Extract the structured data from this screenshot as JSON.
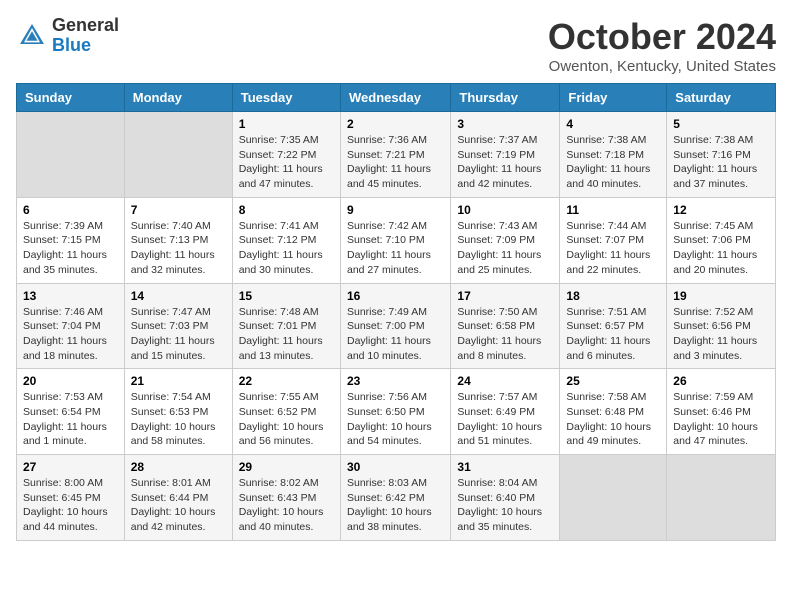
{
  "header": {
    "logo_general": "General",
    "logo_blue": "Blue",
    "month_title": "October 2024",
    "location": "Owenton, Kentucky, United States"
  },
  "days_of_week": [
    "Sunday",
    "Monday",
    "Tuesday",
    "Wednesday",
    "Thursday",
    "Friday",
    "Saturday"
  ],
  "weeks": [
    [
      {
        "day": "",
        "empty": true
      },
      {
        "day": "",
        "empty": true
      },
      {
        "day": "1",
        "sunrise": "Sunrise: 7:35 AM",
        "sunset": "Sunset: 7:22 PM",
        "daylight": "Daylight: 11 hours and 47 minutes."
      },
      {
        "day": "2",
        "sunrise": "Sunrise: 7:36 AM",
        "sunset": "Sunset: 7:21 PM",
        "daylight": "Daylight: 11 hours and 45 minutes."
      },
      {
        "day": "3",
        "sunrise": "Sunrise: 7:37 AM",
        "sunset": "Sunset: 7:19 PM",
        "daylight": "Daylight: 11 hours and 42 minutes."
      },
      {
        "day": "4",
        "sunrise": "Sunrise: 7:38 AM",
        "sunset": "Sunset: 7:18 PM",
        "daylight": "Daylight: 11 hours and 40 minutes."
      },
      {
        "day": "5",
        "sunrise": "Sunrise: 7:38 AM",
        "sunset": "Sunset: 7:16 PM",
        "daylight": "Daylight: 11 hours and 37 minutes."
      }
    ],
    [
      {
        "day": "6",
        "sunrise": "Sunrise: 7:39 AM",
        "sunset": "Sunset: 7:15 PM",
        "daylight": "Daylight: 11 hours and 35 minutes."
      },
      {
        "day": "7",
        "sunrise": "Sunrise: 7:40 AM",
        "sunset": "Sunset: 7:13 PM",
        "daylight": "Daylight: 11 hours and 32 minutes."
      },
      {
        "day": "8",
        "sunrise": "Sunrise: 7:41 AM",
        "sunset": "Sunset: 7:12 PM",
        "daylight": "Daylight: 11 hours and 30 minutes."
      },
      {
        "day": "9",
        "sunrise": "Sunrise: 7:42 AM",
        "sunset": "Sunset: 7:10 PM",
        "daylight": "Daylight: 11 hours and 27 minutes."
      },
      {
        "day": "10",
        "sunrise": "Sunrise: 7:43 AM",
        "sunset": "Sunset: 7:09 PM",
        "daylight": "Daylight: 11 hours and 25 minutes."
      },
      {
        "day": "11",
        "sunrise": "Sunrise: 7:44 AM",
        "sunset": "Sunset: 7:07 PM",
        "daylight": "Daylight: 11 hours and 22 minutes."
      },
      {
        "day": "12",
        "sunrise": "Sunrise: 7:45 AM",
        "sunset": "Sunset: 7:06 PM",
        "daylight": "Daylight: 11 hours and 20 minutes."
      }
    ],
    [
      {
        "day": "13",
        "sunrise": "Sunrise: 7:46 AM",
        "sunset": "Sunset: 7:04 PM",
        "daylight": "Daylight: 11 hours and 18 minutes."
      },
      {
        "day": "14",
        "sunrise": "Sunrise: 7:47 AM",
        "sunset": "Sunset: 7:03 PM",
        "daylight": "Daylight: 11 hours and 15 minutes."
      },
      {
        "day": "15",
        "sunrise": "Sunrise: 7:48 AM",
        "sunset": "Sunset: 7:01 PM",
        "daylight": "Daylight: 11 hours and 13 minutes."
      },
      {
        "day": "16",
        "sunrise": "Sunrise: 7:49 AM",
        "sunset": "Sunset: 7:00 PM",
        "daylight": "Daylight: 11 hours and 10 minutes."
      },
      {
        "day": "17",
        "sunrise": "Sunrise: 7:50 AM",
        "sunset": "Sunset: 6:58 PM",
        "daylight": "Daylight: 11 hours and 8 minutes."
      },
      {
        "day": "18",
        "sunrise": "Sunrise: 7:51 AM",
        "sunset": "Sunset: 6:57 PM",
        "daylight": "Daylight: 11 hours and 6 minutes."
      },
      {
        "day": "19",
        "sunrise": "Sunrise: 7:52 AM",
        "sunset": "Sunset: 6:56 PM",
        "daylight": "Daylight: 11 hours and 3 minutes."
      }
    ],
    [
      {
        "day": "20",
        "sunrise": "Sunrise: 7:53 AM",
        "sunset": "Sunset: 6:54 PM",
        "daylight": "Daylight: 11 hours and 1 minute."
      },
      {
        "day": "21",
        "sunrise": "Sunrise: 7:54 AM",
        "sunset": "Sunset: 6:53 PM",
        "daylight": "Daylight: 10 hours and 58 minutes."
      },
      {
        "day": "22",
        "sunrise": "Sunrise: 7:55 AM",
        "sunset": "Sunset: 6:52 PM",
        "daylight": "Daylight: 10 hours and 56 minutes."
      },
      {
        "day": "23",
        "sunrise": "Sunrise: 7:56 AM",
        "sunset": "Sunset: 6:50 PM",
        "daylight": "Daylight: 10 hours and 54 minutes."
      },
      {
        "day": "24",
        "sunrise": "Sunrise: 7:57 AM",
        "sunset": "Sunset: 6:49 PM",
        "daylight": "Daylight: 10 hours and 51 minutes."
      },
      {
        "day": "25",
        "sunrise": "Sunrise: 7:58 AM",
        "sunset": "Sunset: 6:48 PM",
        "daylight": "Daylight: 10 hours and 49 minutes."
      },
      {
        "day": "26",
        "sunrise": "Sunrise: 7:59 AM",
        "sunset": "Sunset: 6:46 PM",
        "daylight": "Daylight: 10 hours and 47 minutes."
      }
    ],
    [
      {
        "day": "27",
        "sunrise": "Sunrise: 8:00 AM",
        "sunset": "Sunset: 6:45 PM",
        "daylight": "Daylight: 10 hours and 44 minutes."
      },
      {
        "day": "28",
        "sunrise": "Sunrise: 8:01 AM",
        "sunset": "Sunset: 6:44 PM",
        "daylight": "Daylight: 10 hours and 42 minutes."
      },
      {
        "day": "29",
        "sunrise": "Sunrise: 8:02 AM",
        "sunset": "Sunset: 6:43 PM",
        "daylight": "Daylight: 10 hours and 40 minutes."
      },
      {
        "day": "30",
        "sunrise": "Sunrise: 8:03 AM",
        "sunset": "Sunset: 6:42 PM",
        "daylight": "Daylight: 10 hours and 38 minutes."
      },
      {
        "day": "31",
        "sunrise": "Sunrise: 8:04 AM",
        "sunset": "Sunset: 6:40 PM",
        "daylight": "Daylight: 10 hours and 35 minutes."
      },
      {
        "day": "",
        "empty": true
      },
      {
        "day": "",
        "empty": true
      }
    ]
  ]
}
